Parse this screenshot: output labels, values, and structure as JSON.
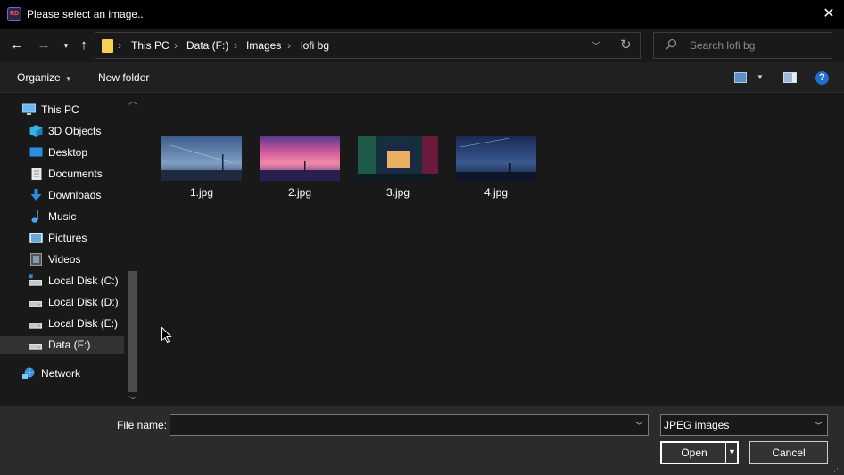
{
  "window": {
    "title": "Please select an image..",
    "app_icon_text": "RD"
  },
  "address": {
    "crumbs": [
      "This PC",
      "Data (F:)",
      "Images",
      "lofi bg"
    ],
    "search_placeholder": "Search lofi bg"
  },
  "toolbar": {
    "organize": "Organize",
    "new_folder": "New folder",
    "help": "?"
  },
  "nav": {
    "items": [
      {
        "label": "This PC",
        "icon": "computer-icon"
      },
      {
        "label": "3D Objects",
        "icon": "cube-icon"
      },
      {
        "label": "Desktop",
        "icon": "desktop-icon"
      },
      {
        "label": "Documents",
        "icon": "document-icon"
      },
      {
        "label": "Downloads",
        "icon": "download-icon"
      },
      {
        "label": "Music",
        "icon": "music-icon"
      },
      {
        "label": "Pictures",
        "icon": "pictures-icon"
      },
      {
        "label": "Videos",
        "icon": "video-icon"
      },
      {
        "label": "Local Disk (C:)",
        "icon": "system-drive-icon"
      },
      {
        "label": "Local Disk (D:)",
        "icon": "drive-icon"
      },
      {
        "label": "Local Disk (E:)",
        "icon": "drive-icon"
      },
      {
        "label": "Data (F:)",
        "icon": "drive-icon",
        "selected": true
      },
      {
        "label": "Network",
        "icon": "network-icon"
      }
    ]
  },
  "files": [
    {
      "name": "1.jpg"
    },
    {
      "name": "2.jpg"
    },
    {
      "name": "3.jpg"
    },
    {
      "name": "4.jpg"
    }
  ],
  "bottom": {
    "file_name_label": "File name:",
    "file_name_value": "",
    "file_type": "JPEG images",
    "open": "Open",
    "cancel": "Cancel"
  },
  "colors": {
    "background": "#191919",
    "titlebar": "#000000",
    "selection": "#323232",
    "bottom_panel": "#2b2b2b"
  }
}
